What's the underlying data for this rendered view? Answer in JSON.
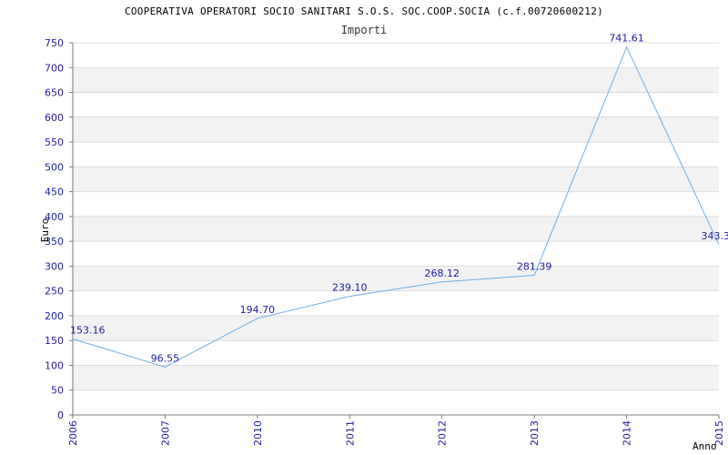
{
  "chart_data": {
    "type": "line",
    "title": "COOPERATIVA OPERATORI SOCIO SANITARI S.O.S. SOC.COOP.SOCIA (c.f.00720600212)",
    "subtitle": "Importi",
    "xlabel": "Anno",
    "ylabel": "Euro",
    "categories": [
      "2006",
      "2007",
      "2010",
      "2011",
      "2012",
      "2013",
      "2014",
      "2015"
    ],
    "values": [
      153.16,
      96.55,
      194.7,
      239.1,
      268.12,
      281.39,
      741.61,
      343.3
    ],
    "value_labels": [
      "153.16",
      "96.55",
      "194.70",
      "239.10",
      "268.12",
      "281.39",
      "741.61",
      "343.3"
    ],
    "ylim": [
      0,
      750
    ],
    "yticks": [
      0,
      50,
      100,
      150,
      200,
      250,
      300,
      350,
      400,
      450,
      500,
      550,
      600,
      650,
      700,
      750
    ],
    "grid": true,
    "legend": "none",
    "colors": {
      "line": "#6aaee8",
      "tick_text": "#1c1ca0",
      "band": "#f2f2f2",
      "gridline": "#dcdcdc",
      "axis": "#7a7a7a",
      "title": "#000000"
    }
  }
}
